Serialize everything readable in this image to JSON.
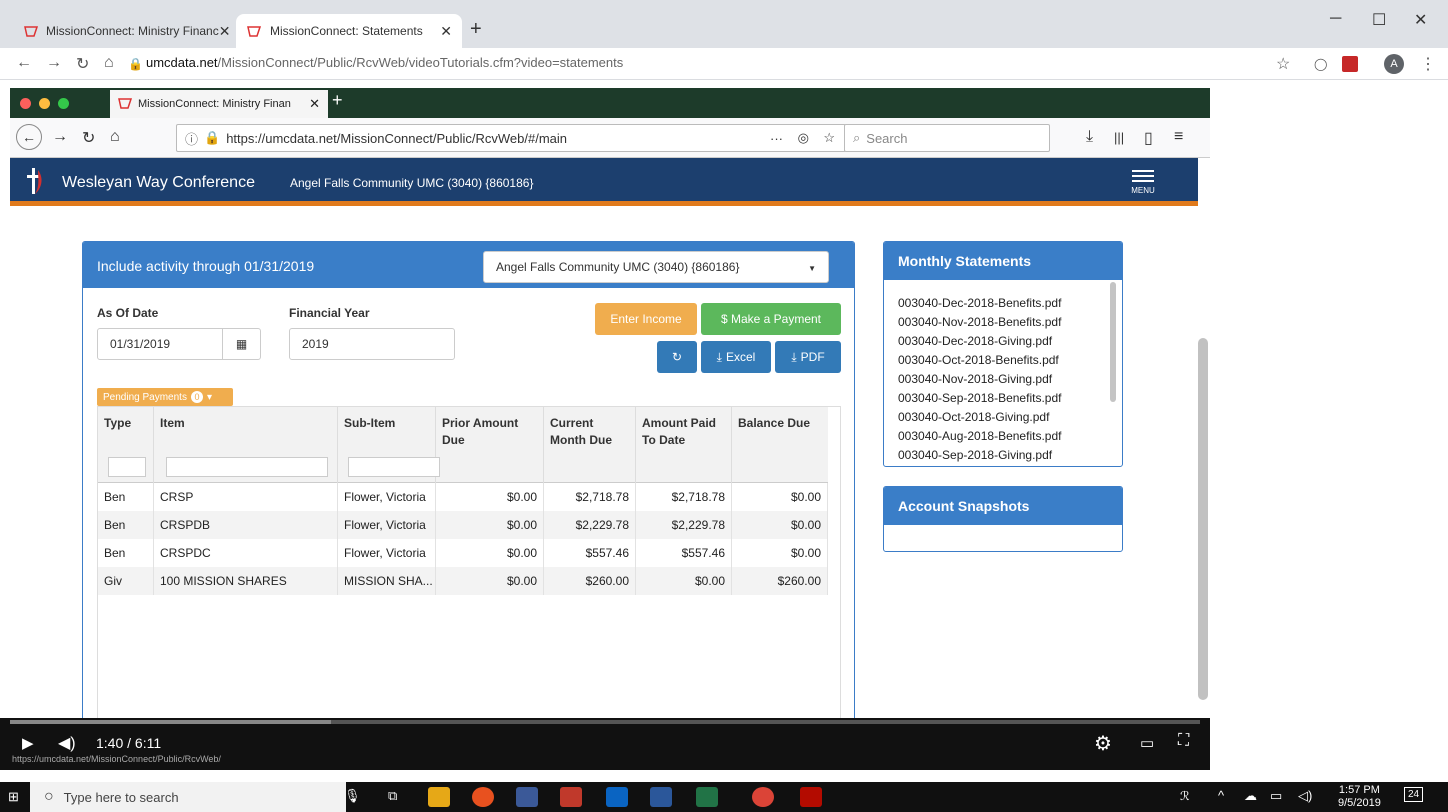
{
  "outer_browser": {
    "tabs": [
      {
        "label": "MissionConnect: Ministry Financ"
      },
      {
        "label": "MissionConnect: Statements"
      }
    ],
    "url_host": "umcdata.net",
    "url_path": "/MissionConnect/Public/RcvWeb/videoTutorials.cfm?video=statements"
  },
  "inner_browser": {
    "tab_label": "MissionConnect: Ministry Finan",
    "url": "https://umcdata.net/MissionConnect/Public/RcvWeb/#/main",
    "search_placeholder": "Search"
  },
  "app": {
    "conference": "Wesleyan Way Conference",
    "church": "Angel Falls Community UMC (3040) {860186}",
    "menu_label": "MENU"
  },
  "main": {
    "heading": "Include activity through 01/31/2019",
    "church_select": "Angel Falls Community UMC (3040) {860186}",
    "as_of_label": "As Of Date",
    "as_of_value": "01/31/2019",
    "fy_label": "Financial Year",
    "fy_value": "2019",
    "buttons": {
      "enter_income": "Enter Income",
      "make_payment": "$ Make a Payment",
      "excel": "Excel",
      "pdf": "PDF"
    },
    "pending_label": "Pending Payments",
    "pending_count": "0",
    "columns": [
      "Type",
      "Item",
      "Sub-Item",
      "Prior Amount Due",
      "Current Month Due",
      "Amount Paid To Date",
      "Balance Due"
    ],
    "rows": [
      [
        "Ben",
        "CRSP",
        "Flower, Victoria",
        "$0.00",
        "$2,718.78",
        "$2,718.78",
        "$0.00"
      ],
      [
        "Ben",
        "CRSPDB",
        "Flower, Victoria",
        "$0.00",
        "$2,229.78",
        "$2,229.78",
        "$0.00"
      ],
      [
        "Ben",
        "CRSPDC",
        "Flower, Victoria",
        "$0.00",
        "$557.46",
        "$557.46",
        "$0.00"
      ],
      [
        "Giv",
        "100 MISSION SHARES",
        "MISSION SHA...",
        "$0.00",
        "$260.00",
        "$0.00",
        "$260.00"
      ]
    ]
  },
  "monthly_statements": {
    "title": "Monthly Statements",
    "files": [
      "003040-Dec-2018-Benefits.pdf",
      "003040-Nov-2018-Benefits.pdf",
      "003040-Dec-2018-Giving.pdf",
      "003040-Oct-2018-Benefits.pdf",
      "003040-Nov-2018-Giving.pdf",
      "003040-Sep-2018-Benefits.pdf",
      "003040-Oct-2018-Giving.pdf",
      "003040-Aug-2018-Benefits.pdf",
      "003040-Sep-2018-Giving.pdf"
    ]
  },
  "account_snapshots": {
    "title": "Account Snapshots"
  },
  "video": {
    "time": "1:40 / 6:11",
    "progress": 0.27,
    "status_url": "https://umcdata.net/MissionConnect/Public/RcvWeb/"
  },
  "taskbar": {
    "search_placeholder": "Type here to search",
    "time": "1:57 PM",
    "date": "9/5/2019",
    "notifications": "24"
  },
  "colors": {
    "header": "#1c3f6e",
    "accent": "#e07a1c",
    "panel": "#3a7ec8",
    "warning": "#f0ad4e",
    "success": "#5cb85c"
  }
}
